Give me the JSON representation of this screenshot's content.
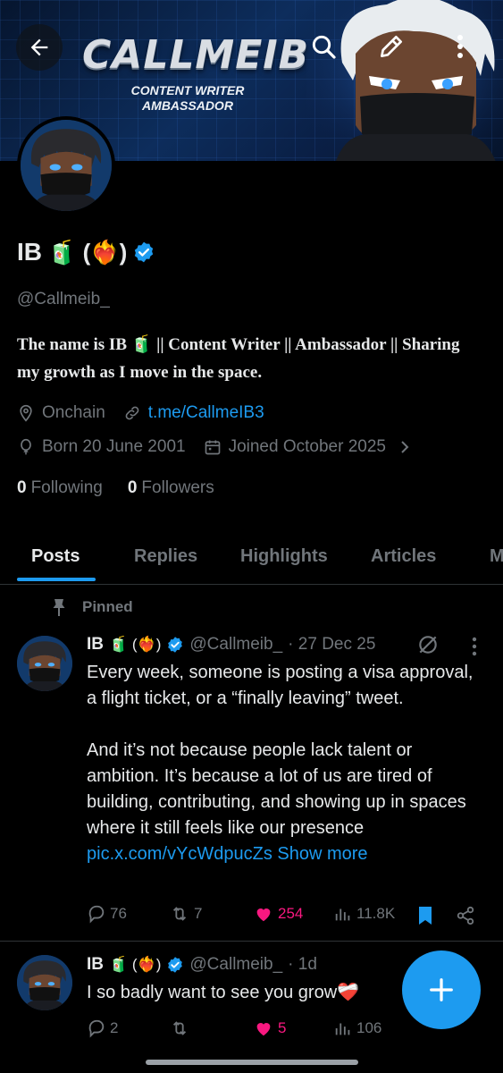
{
  "banner": {
    "brand": "CALLMEIB",
    "tagline": "CONTENT WRITER AMBASSADOR"
  },
  "profile": {
    "name": "IB",
    "name_emojis": "🧃 (❤️‍🔥)",
    "handle": "@Callmeib_",
    "bio": "The name is IB 🧃 || Content Writer || Ambassador || Sharing my growth as I move in the space.",
    "location": "Onchain",
    "link": "t.me/CallmeIB3",
    "born": "Born 20 June 2001",
    "joined": "Joined October 2025",
    "following_count": "0",
    "following_label": "Following",
    "followers_count": "0",
    "followers_label": "Followers"
  },
  "tabs": [
    "Posts",
    "Replies",
    "Highlights",
    "Articles",
    "M"
  ],
  "pinned_label": "Pinned",
  "posts": [
    {
      "name": "IB",
      "emojis": "🧃 (❤️‍🔥)",
      "handle": "@Callmeib_",
      "date": "· 27 Dec 25",
      "body_1": "Every week, someone is posting a visa approval, a flight ticket, or a “finally leaving” tweet.",
      "body_2": "And it’s not because people lack talent or ambition. It’s because a lot of us are tired of building, contributing, and showing up in spaces where it still feels like our presence",
      "link": "pic.x.com/vYcWdpucZs",
      "show_more": "Show more",
      "replies": "76",
      "reposts": "7",
      "likes": "254",
      "views": "11.8K"
    },
    {
      "name": "IB",
      "emojis": "🧃 (❤️‍🔥)",
      "handle": "@Callmeib_",
      "date": "· 1d",
      "body": "I so badly want to see you grow❤️‍🩹",
      "replies": "2",
      "reposts": "",
      "likes": "5",
      "views": "106"
    }
  ],
  "colors": {
    "accent": "#1d9bf0",
    "muted": "#71767b",
    "like": "#f91880",
    "text": "#e7e9ea",
    "background": "#000000"
  }
}
